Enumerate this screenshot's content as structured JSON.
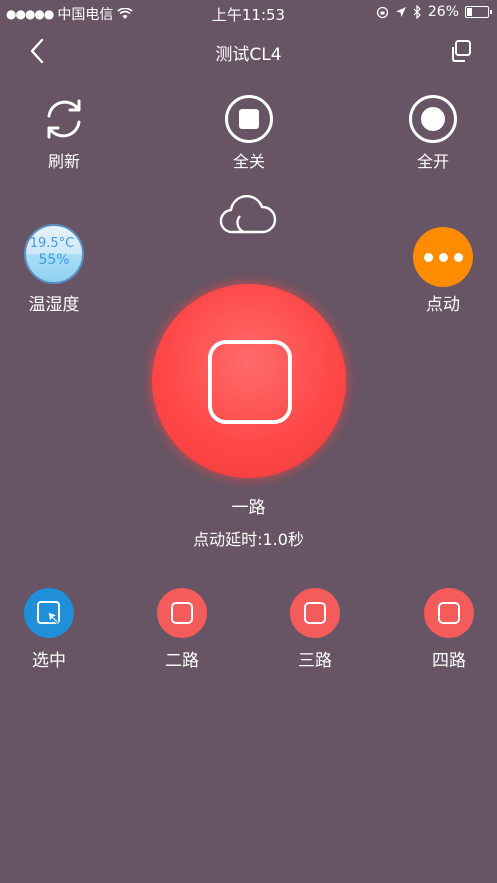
{
  "status_bar": {
    "signal": "●●●●●",
    "carrier": "中国电信",
    "time": "上午11:53",
    "battery_percent_text": "26%",
    "battery_level": 0.26
  },
  "nav": {
    "title": "测试CL4"
  },
  "actions": {
    "refresh_label": "刷新",
    "all_off_label": "全关",
    "all_on_label": "全开"
  },
  "sensor": {
    "temperature": "19.5°C",
    "humidity": "55%",
    "label": "温湿度"
  },
  "mode": {
    "label": "点动"
  },
  "main_switch": {
    "channel_name": "一路",
    "delay_text": "点动延时:1.0秒"
  },
  "channels": [
    {
      "label": "选中",
      "state": "selected"
    },
    {
      "label": "二路",
      "state": "off"
    },
    {
      "label": "三路",
      "state": "off"
    },
    {
      "label": "四路",
      "state": "off"
    }
  ],
  "colors": {
    "background": "#675565",
    "switch_red": "#ff4848",
    "mode_orange": "#ff8c00",
    "selected_blue": "#1e8fd8"
  }
}
